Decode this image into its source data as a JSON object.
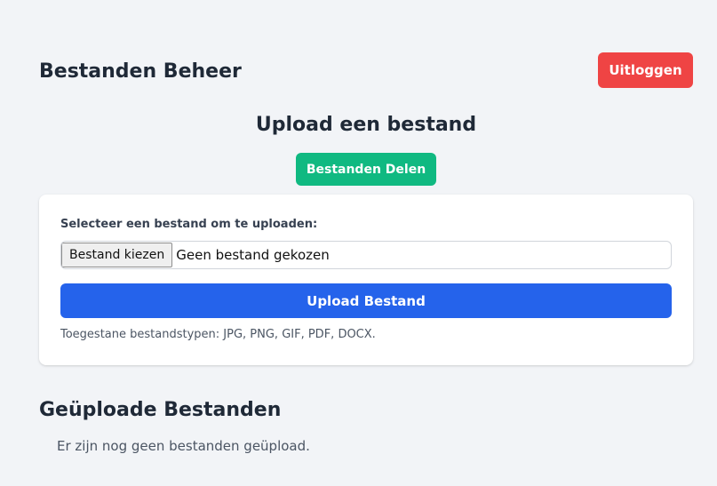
{
  "header": {
    "title": "Bestanden Beheer",
    "logout_label": "Uitloggen"
  },
  "upload": {
    "title": "Upload een bestand",
    "share_label": "Bestanden Delen",
    "field_label": "Selecteer een bestand om te uploaden:",
    "choose_label": "Bestand kiezen",
    "file_status": "Geen bestand gekozen",
    "submit_label": "Upload Bestand",
    "hint": "Toegestane bestandstypen: JPG, PNG, GIF, PDF, DOCX."
  },
  "files": {
    "title": "Geüploade Bestanden",
    "empty_message": "Er zijn nog geen bestanden geüpload."
  },
  "colors": {
    "background": "#f2f4f7",
    "logout": "#ef4444",
    "share": "#10b981",
    "upload": "#2563eb"
  }
}
